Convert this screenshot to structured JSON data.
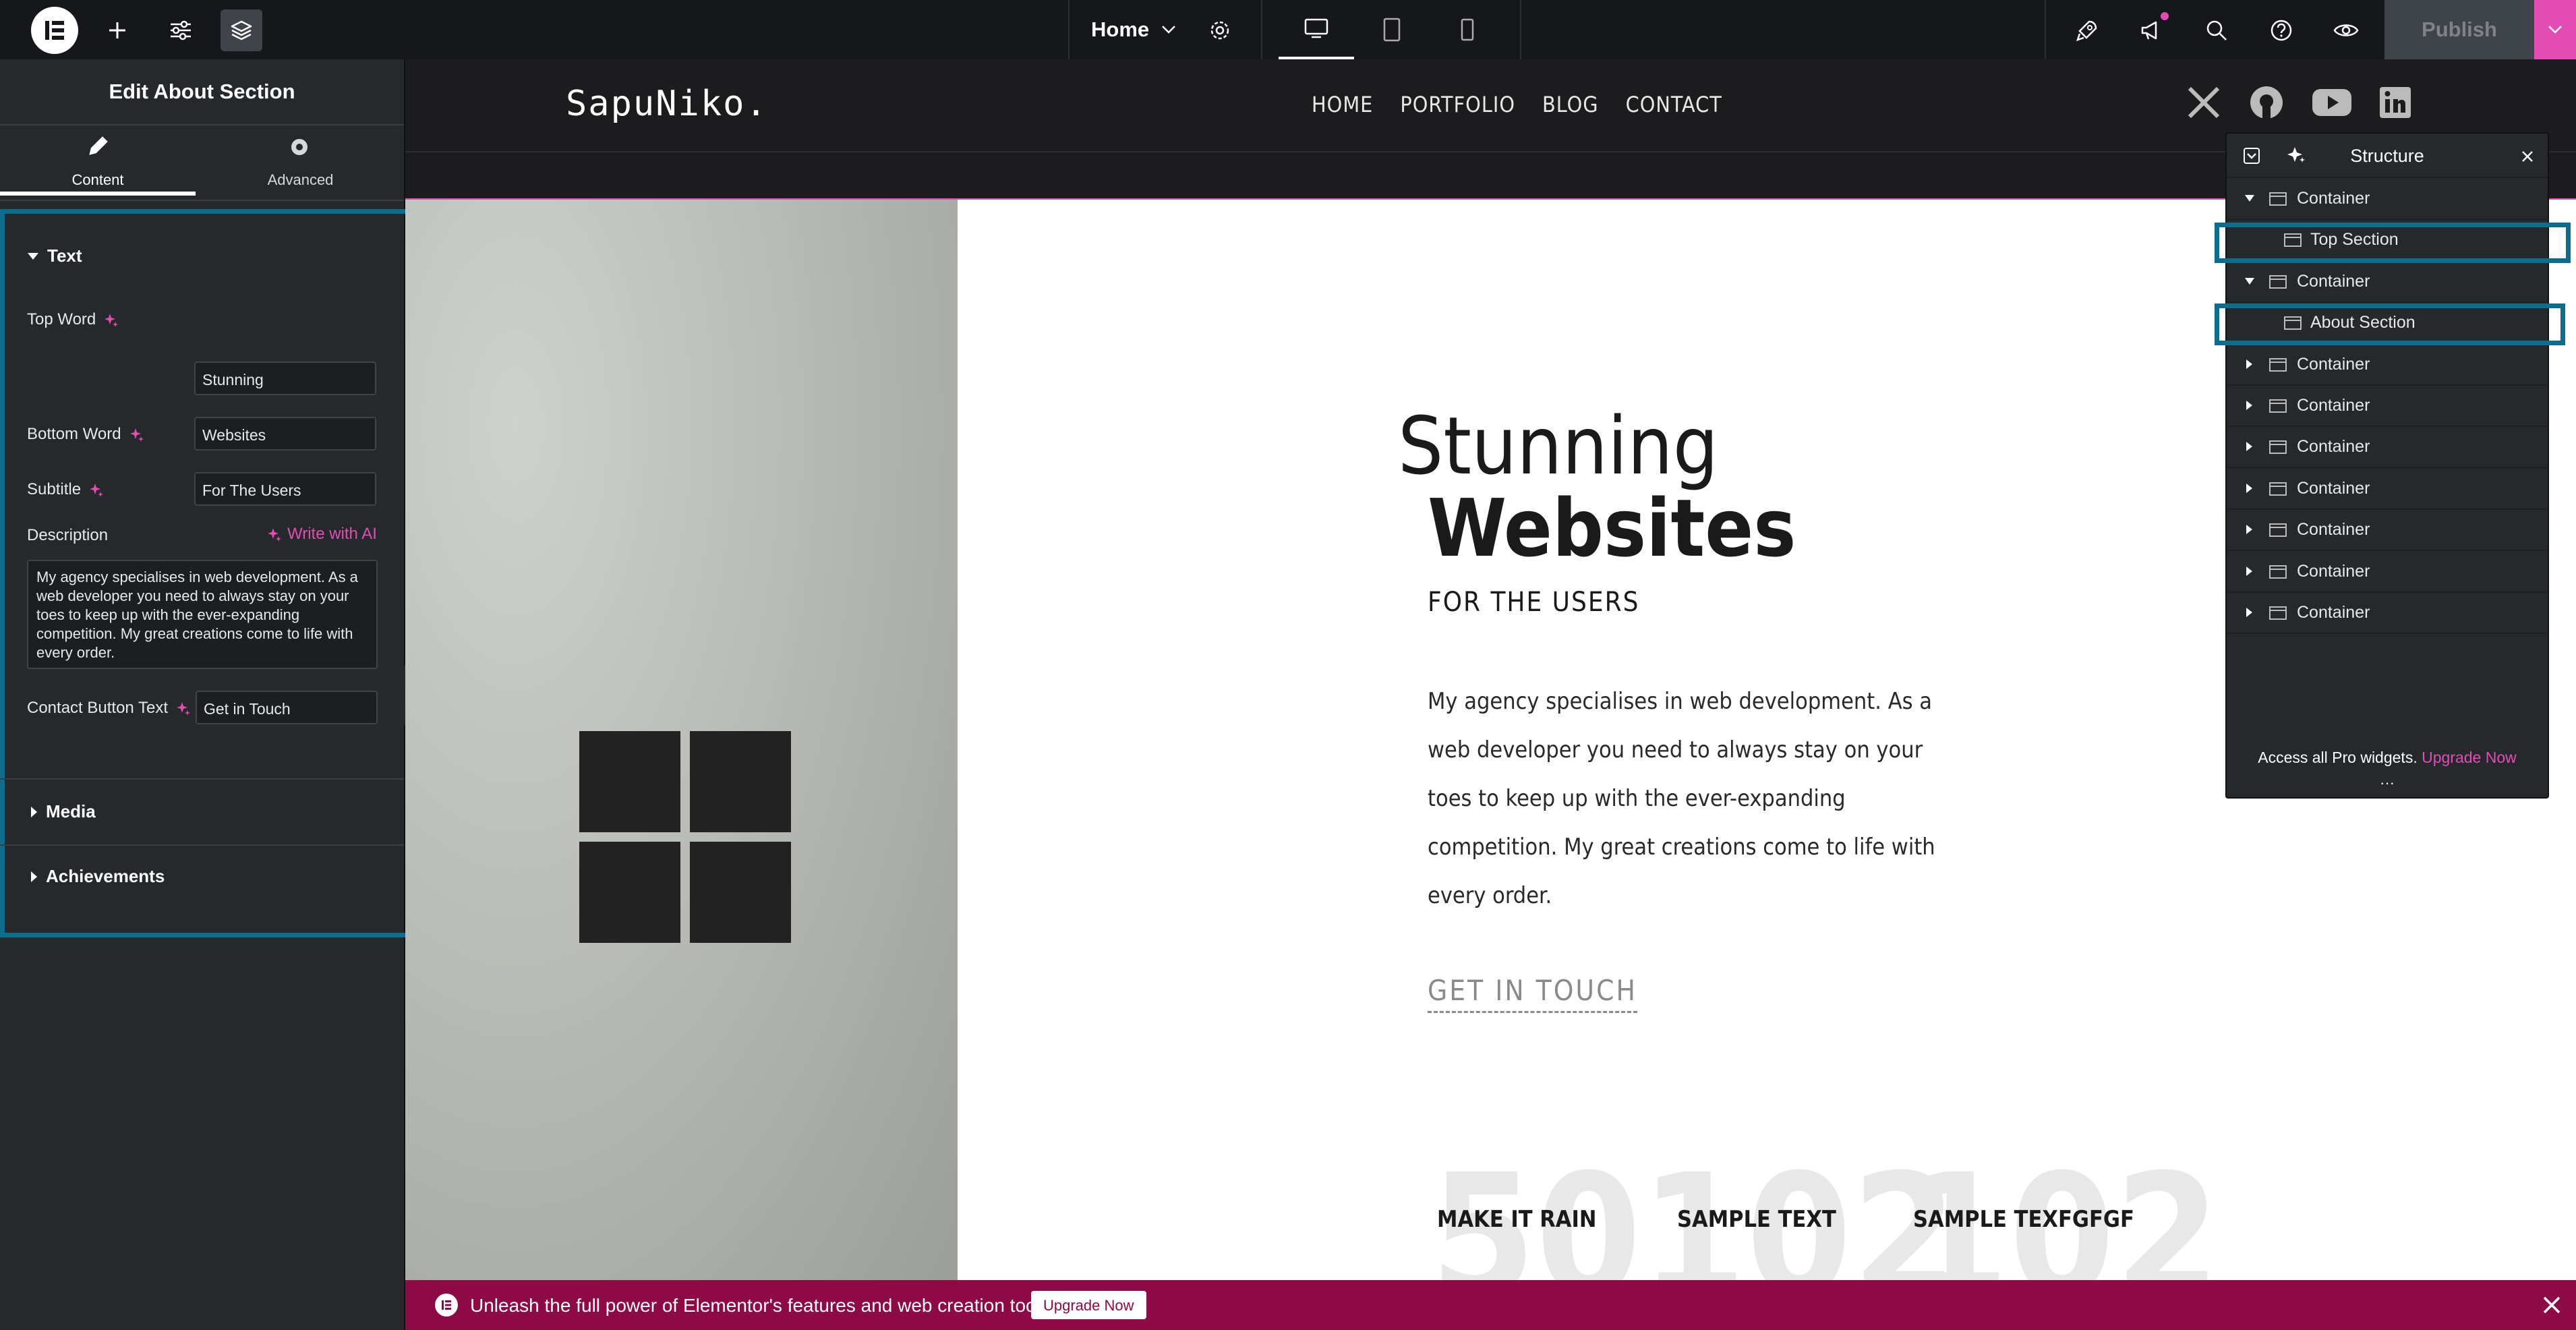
{
  "topbar": {
    "page_name": "Home",
    "publish_label": "Publish"
  },
  "left_panel": {
    "title": "Edit About Section",
    "tabs": [
      {
        "label": "Content",
        "icon": "pencil-icon",
        "active": true
      },
      {
        "label": "Advanced",
        "icon": "gear-icon",
        "active": false
      }
    ],
    "text_section": {
      "title": "Text",
      "fields": [
        {
          "label": "Top Word",
          "value": "Stunning"
        },
        {
          "label": "Bottom Word",
          "value": "Websites"
        },
        {
          "label": "Subtitle",
          "value": "For The Users"
        }
      ],
      "description_label": "Description",
      "write_ai_label": "Write with AI",
      "description_value": "My agency specialises in web development. As a web developer you need to always stay on your toes to keep up with the ever-expanding competition. My great creations come to life with every order.",
      "contact_label": "Contact Button Text",
      "contact_value": "Get in Touch"
    },
    "media_title": "Media",
    "achievements_title": "Achievements"
  },
  "site": {
    "logo": "SapuNiko.",
    "nav": [
      "HOME",
      "PORTFOLIO",
      "BLOG",
      "CONTACT"
    ],
    "top_word": "Stunning",
    "bottom_word": "Websites",
    "subtitle": "FOR THE USERS",
    "description_lines": [
      "My agency specialises in web development. As a",
      "web developer you need to always stay on your",
      "toes to keep up with the ever-expanding",
      "competition. My great creations come to life with",
      "every order."
    ],
    "cta": "GET IN TOUCH",
    "stats": [
      {
        "number": "50",
        "label": "MAKE IT RAIN"
      },
      {
        "number": "102",
        "label": "SAMPLE TEXT"
      },
      {
        "number": "102",
        "label": "SAMPLE TEXFGFGF"
      }
    ]
  },
  "structure": {
    "title": "Structure",
    "rows": [
      {
        "label": "Container",
        "level": 0,
        "expanded": true
      },
      {
        "label": "Top Section",
        "level": 1,
        "highlight": true
      },
      {
        "label": "Container",
        "level": 0,
        "expanded": true
      },
      {
        "label": "About Section",
        "level": 1,
        "highlight": true
      },
      {
        "label": "Container",
        "level": 0,
        "expanded": false
      },
      {
        "label": "Container",
        "level": 0,
        "expanded": false
      },
      {
        "label": "Container",
        "level": 0,
        "expanded": false
      },
      {
        "label": "Container",
        "level": 0,
        "expanded": false
      },
      {
        "label": "Container",
        "level": 0,
        "expanded": false
      },
      {
        "label": "Container",
        "level": 0,
        "expanded": false
      },
      {
        "label": "Container",
        "level": 0,
        "expanded": false
      }
    ],
    "pro_text": "Access all Pro widgets.",
    "upgrade_link": "Upgrade Now"
  },
  "banner": {
    "text": "Unleash the full power of Elementor's features and web creation tools.",
    "button": "Upgrade Now"
  },
  "colors": {
    "accent_pink": "#e34cb4",
    "highlight_blue": "#0b6e8f",
    "banner_bg": "#8d0a47"
  }
}
